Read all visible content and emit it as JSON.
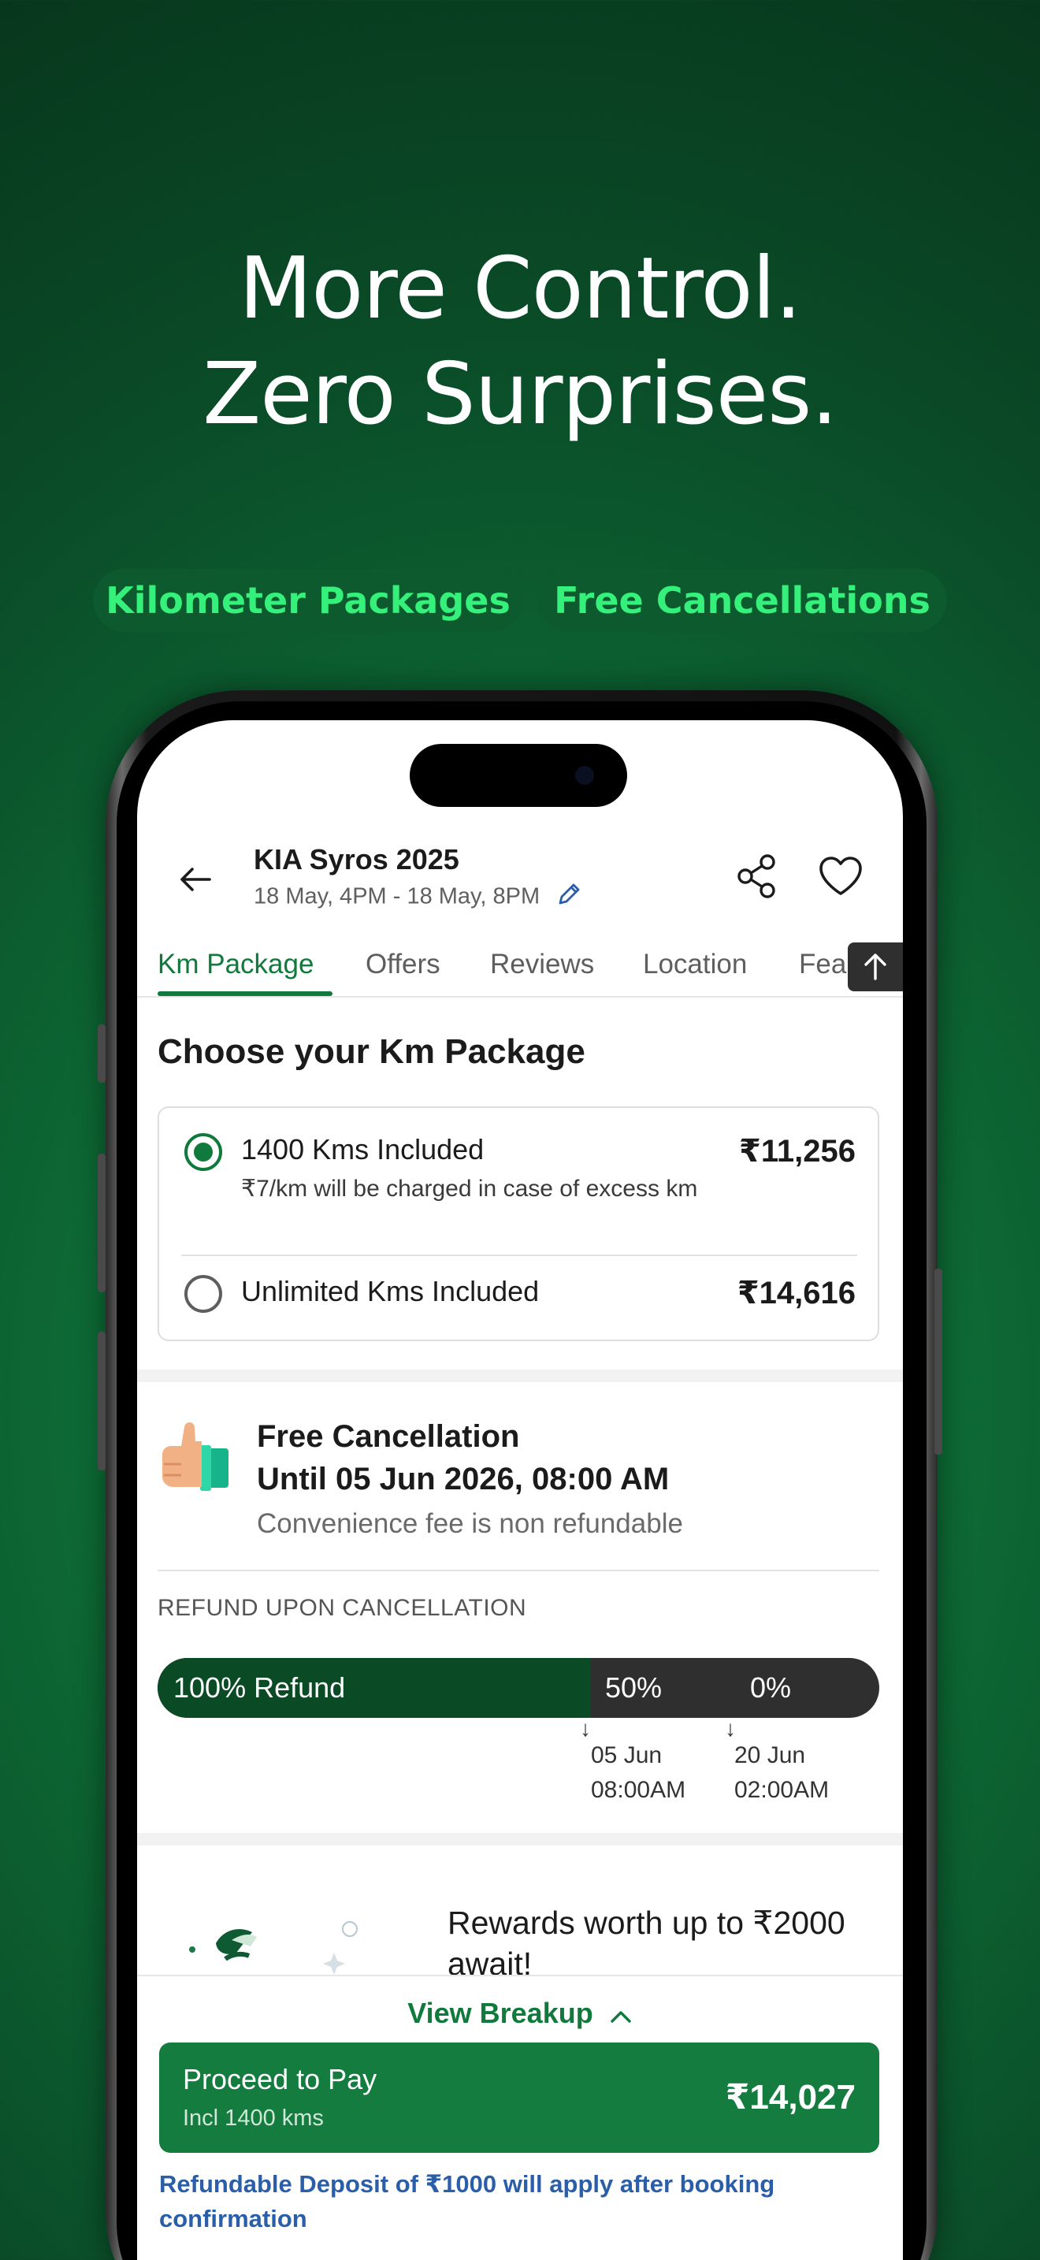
{
  "headline": {
    "line1": "More Control.",
    "line2": "Zero Surprises."
  },
  "pills": [
    "Kilometer Packages",
    "Free Cancellations"
  ],
  "header": {
    "title": "KIA Syros 2025",
    "subtitle": "18 May, 4PM - 18 May, 8PM"
  },
  "tabs": [
    "Km Package",
    "Offers",
    "Reviews",
    "Location",
    "Fea"
  ],
  "km_section": {
    "title": "Choose your Km Package",
    "packages": [
      {
        "label": "1400 Kms Included",
        "price": "₹11,256",
        "note": "₹7/km will be charged in case of excess km",
        "selected": true
      },
      {
        "label": "Unlimited Kms Included",
        "price": "₹14,616",
        "selected": false
      }
    ]
  },
  "cancellation": {
    "title_line1": "Free Cancellation",
    "title_line2": "Until 05 Jun 2026, 08:00 AM",
    "subtitle": "Convenience fee is non refundable",
    "refund_heading": "REFUND UPON CANCELLATION",
    "segments": [
      "100% Refund",
      "50%",
      "0%"
    ],
    "full_refund_fraction": 0.6,
    "milestones": [
      {
        "date": "05 Jun",
        "time": "08:00AM"
      },
      {
        "date": "20 Jun",
        "time": "02:00AM"
      }
    ]
  },
  "rewards": {
    "text": "Rewards worth up to ₹2000 await!"
  },
  "bottom": {
    "view_breakup": "View Breakup",
    "pay_label": "Proceed to Pay",
    "pay_sub": "Incl 1400 kms",
    "pay_amount": "₹14,027",
    "deposit_note": "Refundable Deposit of ₹1000 will apply after booking confirmation"
  },
  "colors": {
    "brand_green": "#0f7a3b",
    "pill_text": "#35f07a",
    "refund_fill": "#0a4a25",
    "link_blue": "#2a5ea8"
  }
}
